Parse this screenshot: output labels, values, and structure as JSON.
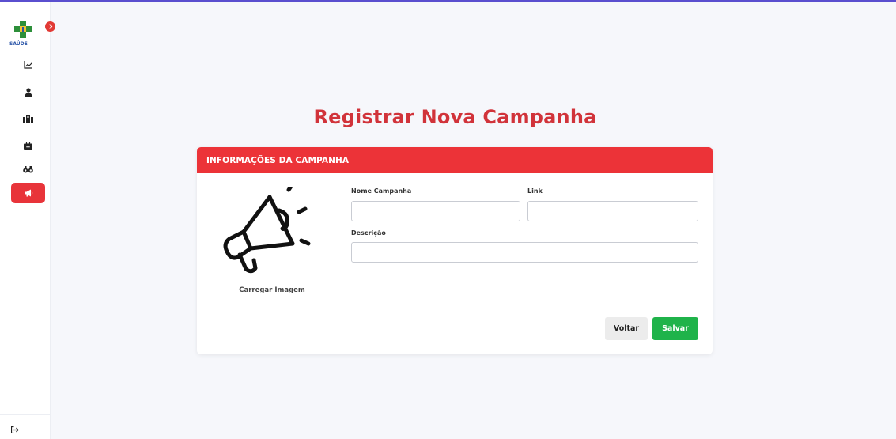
{
  "logo": {
    "text": "SAÚDE"
  },
  "sidebar": {
    "items": [
      {
        "icon": "chart-line-icon",
        "active": false
      },
      {
        "icon": "user-icon",
        "active": false
      },
      {
        "icon": "hospital-icon",
        "active": false
      },
      {
        "icon": "medkit-icon",
        "active": false
      },
      {
        "icon": "binoculars-icon",
        "active": false
      },
      {
        "icon": "megaphone-icon",
        "active": true
      }
    ],
    "logout_icon": "logout-icon"
  },
  "page": {
    "title": "Registrar Nova Campanha"
  },
  "card": {
    "header": "INFORMAÇÕES DA CAMPANHA",
    "image_label": "Carregar Imagem",
    "fields": {
      "nome": {
        "label": "Nome Campanha",
        "value": ""
      },
      "link": {
        "label": "Link",
        "value": ""
      },
      "descricao": {
        "label": "Descrição",
        "value": ""
      }
    },
    "buttons": {
      "back": "Voltar",
      "save": "Salvar"
    }
  },
  "colors": {
    "accent": "#ec3338",
    "title": "#d1333a",
    "save": "#1fb34a",
    "topline": "#5a4fcf"
  }
}
